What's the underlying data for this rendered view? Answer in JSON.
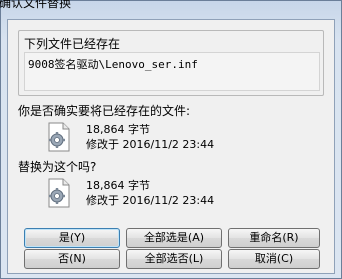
{
  "window": {
    "title": "确认文件替换"
  },
  "group": {
    "label": "下列文件已经存在",
    "path": "9008签名驱动\\Lenovo_ser.inf"
  },
  "existing": {
    "question": "你是否确实要将已经存在的文件:",
    "size": "18,864 字节",
    "modified": "修改于 2016/11/2 23:44",
    "icon": "settings-file-icon"
  },
  "replacement": {
    "question": "替换为这个吗?",
    "size": "18,864 字节",
    "modified": "修改于 2016/11/2 23:44",
    "icon": "settings-file-icon"
  },
  "buttons": {
    "yes": "是(Y)",
    "yes_all": "全部选是(A)",
    "rename": "重命名(R)",
    "no": "否(N)",
    "no_all": "全部选否(L)",
    "cancel": "取消(C)"
  }
}
